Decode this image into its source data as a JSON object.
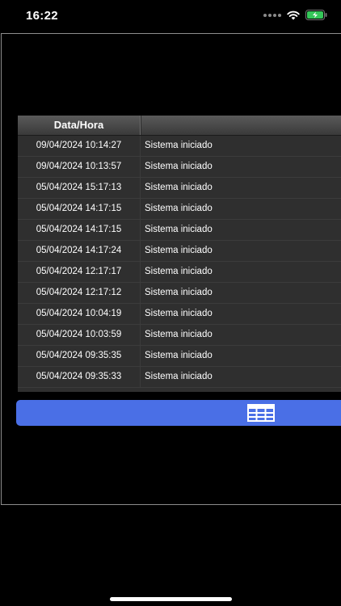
{
  "status_bar": {
    "time": "16:22",
    "battery_color": "#35c759"
  },
  "table": {
    "header_date": "Data/Hora",
    "header_message": "",
    "rows": [
      {
        "date": "09/04/2024 10:14:27",
        "message": "Sistema iniciado"
      },
      {
        "date": "09/04/2024 10:13:57",
        "message": "Sistema iniciado"
      },
      {
        "date": "05/04/2024 15:17:13",
        "message": "Sistema iniciado"
      },
      {
        "date": "05/04/2024 14:17:15",
        "message": "Sistema iniciado"
      },
      {
        "date": "05/04/2024 14:17:15",
        "message": "Sistema iniciado"
      },
      {
        "date": "05/04/2024 14:17:24",
        "message": "Sistema iniciado"
      },
      {
        "date": "05/04/2024 12:17:17",
        "message": "Sistema iniciado"
      },
      {
        "date": "05/04/2024 12:17:12",
        "message": "Sistema iniciado"
      },
      {
        "date": "05/04/2024 10:04:19",
        "message": "Sistema iniciado"
      },
      {
        "date": "05/04/2024 10:03:59",
        "message": "Sistema iniciado"
      },
      {
        "date": "05/04/2024 09:35:35",
        "message": "Sistema iniciado"
      },
      {
        "date": "05/04/2024 09:35:33",
        "message": "Sistema iniciado"
      }
    ]
  },
  "toolbar": {
    "color": "#4a6fe6",
    "grid_icon": "table-grid-icon"
  }
}
